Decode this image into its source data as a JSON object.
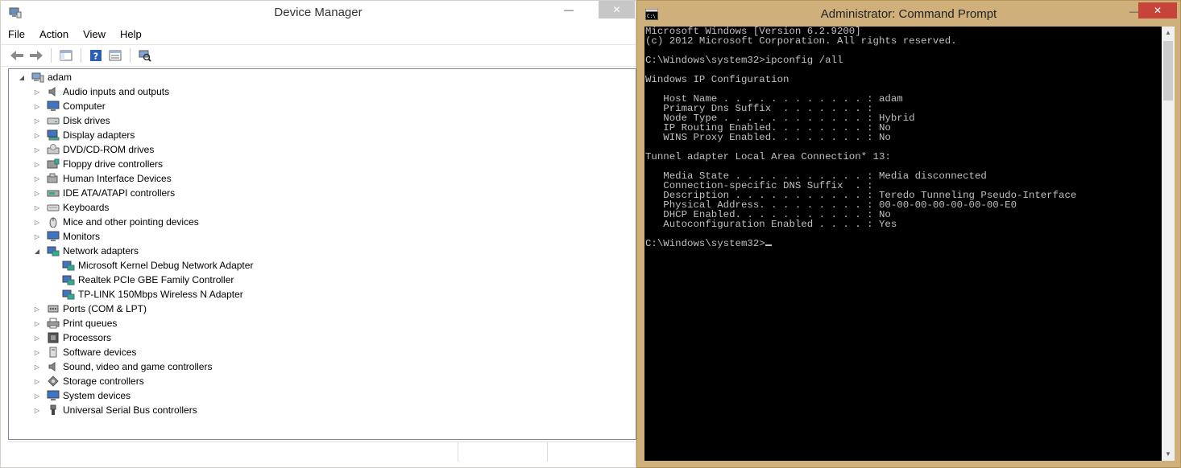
{
  "device_manager": {
    "title": "Device Manager",
    "menu": [
      "File",
      "Action",
      "View",
      "Help"
    ],
    "tree": [
      {
        "label": "adam",
        "level": 0,
        "expanded": true,
        "icon": "computer-icon"
      },
      {
        "label": "Audio inputs and outputs",
        "level": 1,
        "expanded": false,
        "icon": "speaker-icon"
      },
      {
        "label": "Computer",
        "level": 1,
        "expanded": false,
        "icon": "monitor-icon"
      },
      {
        "label": "Disk drives",
        "level": 1,
        "expanded": false,
        "icon": "disk-drive-icon"
      },
      {
        "label": "Display adapters",
        "level": 1,
        "expanded": false,
        "icon": "display-adapter-icon"
      },
      {
        "label": "DVD/CD-ROM drives",
        "level": 1,
        "expanded": false,
        "icon": "dvd-drive-icon"
      },
      {
        "label": "Floppy drive controllers",
        "level": 1,
        "expanded": false,
        "icon": "floppy-controller-icon"
      },
      {
        "label": "Human Interface Devices",
        "level": 1,
        "expanded": false,
        "icon": "hid-icon"
      },
      {
        "label": "IDE ATA/ATAPI controllers",
        "level": 1,
        "expanded": false,
        "icon": "ide-controller-icon"
      },
      {
        "label": "Keyboards",
        "level": 1,
        "expanded": false,
        "icon": "keyboard-icon"
      },
      {
        "label": "Mice and other pointing devices",
        "level": 1,
        "expanded": false,
        "icon": "mouse-icon"
      },
      {
        "label": "Monitors",
        "level": 1,
        "expanded": false,
        "icon": "monitor-icon"
      },
      {
        "label": "Network adapters",
        "level": 1,
        "expanded": true,
        "icon": "network-adapter-icon"
      },
      {
        "label": "Microsoft Kernel Debug Network Adapter",
        "level": 2,
        "expanded": null,
        "icon": "network-adapter-icon"
      },
      {
        "label": "Realtek PCIe GBE Family Controller",
        "level": 2,
        "expanded": null,
        "icon": "network-adapter-icon"
      },
      {
        "label": "TP-LINK 150Mbps Wireless N Adapter",
        "level": 2,
        "expanded": null,
        "icon": "network-adapter-icon"
      },
      {
        "label": "Ports (COM & LPT)",
        "level": 1,
        "expanded": false,
        "icon": "port-icon"
      },
      {
        "label": "Print queues",
        "level": 1,
        "expanded": false,
        "icon": "printer-icon"
      },
      {
        "label": "Processors",
        "level": 1,
        "expanded": false,
        "icon": "processor-icon"
      },
      {
        "label": "Software devices",
        "level": 1,
        "expanded": false,
        "icon": "software-device-icon"
      },
      {
        "label": "Sound, video and game controllers",
        "level": 1,
        "expanded": false,
        "icon": "speaker-icon"
      },
      {
        "label": "Storage controllers",
        "level": 1,
        "expanded": false,
        "icon": "storage-controller-icon"
      },
      {
        "label": "System devices",
        "level": 1,
        "expanded": false,
        "icon": "monitor-icon"
      },
      {
        "label": "Universal Serial Bus controllers",
        "level": 1,
        "expanded": false,
        "icon": "usb-icon"
      }
    ]
  },
  "command_prompt": {
    "title": "Administrator: Command Prompt",
    "text_color": "#c0c0c0",
    "lines": [
      "Microsoft Windows [Version 6.2.9200]",
      "(c) 2012 Microsoft Corporation. All rights reserved.",
      "",
      "C:\\Windows\\system32>ipconfig /all",
      "",
      "Windows IP Configuration",
      "",
      "   Host Name . . . . . . . . . . . . : adam",
      "   Primary Dns Suffix  . . . . . . . :",
      "   Node Type . . . . . . . . . . . . : Hybrid",
      "   IP Routing Enabled. . . . . . . . : No",
      "   WINS Proxy Enabled. . . . . . . . : No",
      "",
      "Tunnel adapter Local Area Connection* 13:",
      "",
      "   Media State . . . . . . . . . . . : Media disconnected",
      "   Connection-specific DNS Suffix  . :",
      "   Description . . . . . . . . . . . : Teredo Tunneling Pseudo-Interface",
      "   Physical Address. . . . . . . . . : 00-00-00-00-00-00-00-E0",
      "   DHCP Enabled. . . . . . . . . . . : No",
      "   Autoconfiguration Enabled . . . . : Yes",
      ""
    ],
    "prompt": "C:\\Windows\\system32>"
  }
}
